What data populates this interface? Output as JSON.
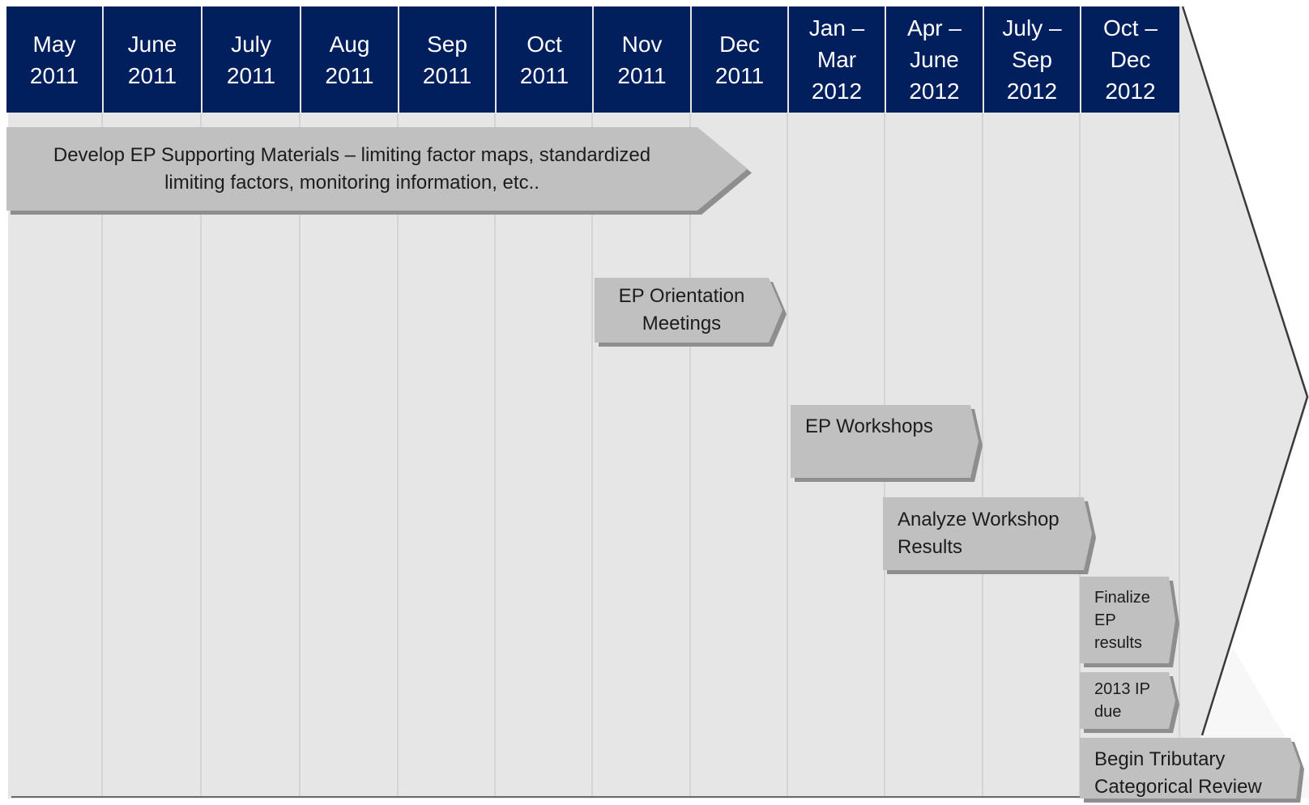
{
  "timeline": {
    "periods": [
      {
        "label": "May\n2011"
      },
      {
        "label": "June\n2011"
      },
      {
        "label": "July\n2011"
      },
      {
        "label": "Aug\n2011"
      },
      {
        "label": "Sep\n2011"
      },
      {
        "label": "Oct\n2011"
      },
      {
        "label": "Nov\n2011"
      },
      {
        "label": "Dec\n2011"
      },
      {
        "label": "Jan –\nMar\n2012"
      },
      {
        "label": "Apr –\nJune\n2012"
      },
      {
        "label": "July –\nSep\n2012"
      },
      {
        "label": "Oct –\nDec\n2012"
      }
    ],
    "tasks": [
      {
        "label": "Develop EP Supporting Materials – limiting factor maps, standardized\nlimiting factors, monitoring information, etc.."
      },
      {
        "label": "EP Orientation\nMeetings"
      },
      {
        "label": "EP Workshops"
      },
      {
        "label": "Analyze Workshop\nResults"
      },
      {
        "label": "Finalize\nEP\nresults"
      },
      {
        "label": "2013 IP\ndue"
      },
      {
        "label": "Begin Tributary\nCategorical Review"
      }
    ]
  },
  "colors": {
    "header_bg": "#001f5c",
    "header_text": "#ffffff",
    "arrow_fill": "#e6e6e6",
    "task_fill": "#c0c0c0",
    "task_shadow": "#8e8e8e",
    "grid_line": "#d4d4d4"
  }
}
